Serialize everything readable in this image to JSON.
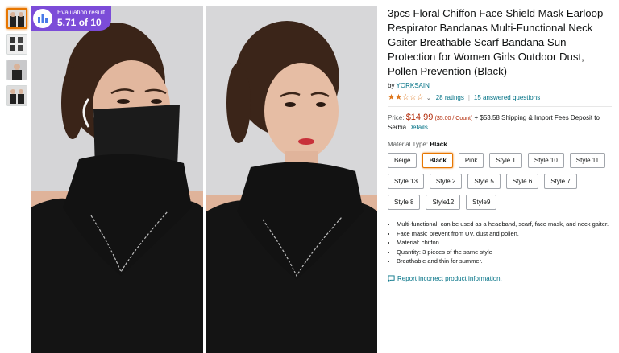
{
  "badge": {
    "label": "Evaluation result",
    "score": "5.71 of 10",
    "icon": "bar-chart-icon",
    "color": "#7c4cd8"
  },
  "product": {
    "title": "3pcs Floral Chiffon Face Shield Mask Earloop Respirator Bandanas Multi-Functional Neck Gaiter Breathable Scarf Bandana Sun Protection for Women Girls Outdoor Dust, Pollen Prevention (Black)",
    "by_prefix": "by",
    "brand": "YORKSAIN",
    "stars": "★★☆☆☆",
    "rating_value": 2.5,
    "ratings": "28 ratings",
    "answered": "15 answered questions",
    "price_label": "Price:",
    "price": "$14.99",
    "unit_price": "($5.00 / Count)",
    "shipping": "+ $53.58 Shipping & Import Fees Deposit to Serbia",
    "details_link": "Details",
    "material_label": "Material Type:",
    "material_value": "Black",
    "options": [
      "Beige",
      "Black",
      "Pink",
      "Style 1",
      "Style 10",
      "Style 11",
      "Style 13",
      "Style 2",
      "Style 5",
      "Style 6",
      "Style 7",
      "Style 8",
      "Style12",
      "Style9"
    ],
    "selected_option": "Black",
    "bullets": [
      "Multi-functional: can be used as a headband, scarf, face mask, and neck gaiter.",
      "Face mask: prevent from UV, dust and pollen.",
      "Material: chiffon",
      "Quantity: 3 pieces of the same style",
      "Breathable and thin for summer."
    ],
    "report": "Report incorrect product information."
  },
  "colors": {
    "link": "#007185",
    "price": "#b12704",
    "star": "#de7921",
    "selected": "#e77600"
  }
}
